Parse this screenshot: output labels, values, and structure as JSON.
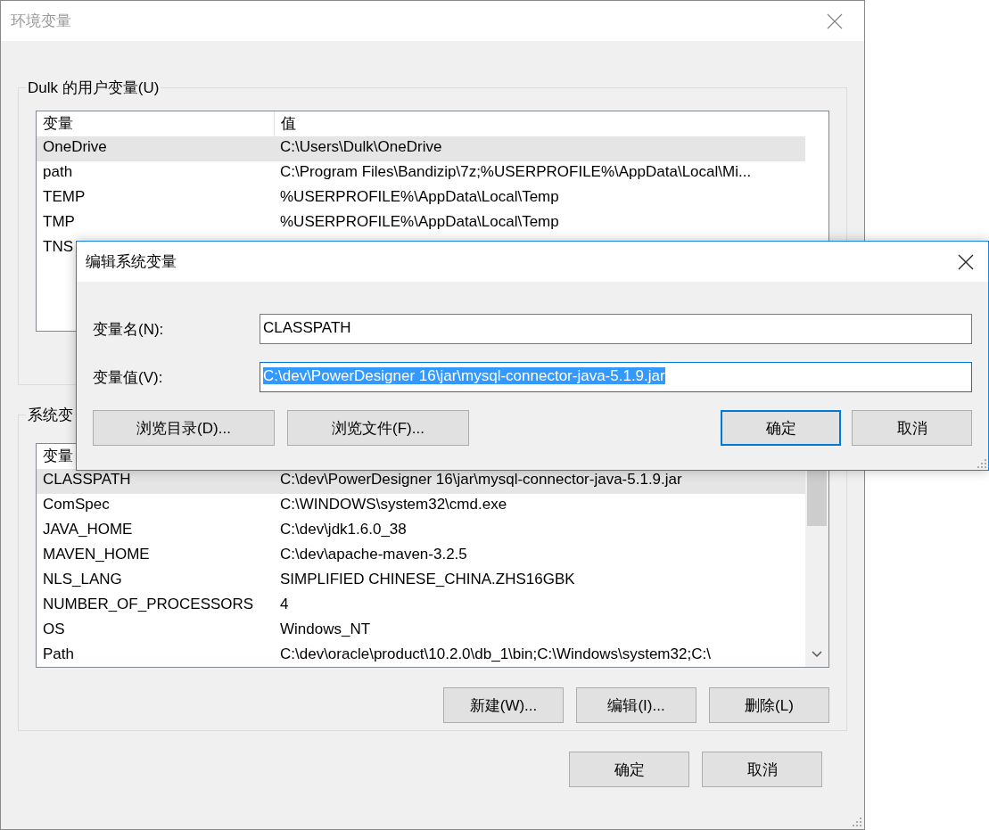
{
  "window": {
    "title": "环境变量"
  },
  "user_variables": {
    "label": "Dulk 的用户变量(U)",
    "columns": [
      "变量",
      "值"
    ],
    "rows": [
      {
        "name": "OneDrive",
        "value": "C:\\Users\\Dulk\\OneDrive",
        "selected": true
      },
      {
        "name": "path",
        "value": "C:\\Program Files\\Bandizip\\7z;%USERPROFILE%\\AppData\\Local\\Mi...",
        "selected": false
      },
      {
        "name": "TEMP",
        "value": "%USERPROFILE%\\AppData\\Local\\Temp",
        "selected": false
      },
      {
        "name": "TMP",
        "value": "%USERPROFILE%\\AppData\\Local\\Temp",
        "selected": false
      },
      {
        "name": "TNS",
        "selected": false
      }
    ]
  },
  "system_variables": {
    "label": "系统变",
    "columns": [
      "变量"
    ],
    "rows": [
      {
        "name": "CLASSPATH",
        "value": "C:\\dev\\PowerDesigner 16\\jar\\mysql-connector-java-5.1.9.jar",
        "selected": true
      },
      {
        "name": "ComSpec",
        "value": "C:\\WINDOWS\\system32\\cmd.exe",
        "selected": false
      },
      {
        "name": "JAVA_HOME",
        "value": "C:\\dev\\jdk1.6.0_38",
        "selected": false
      },
      {
        "name": "MAVEN_HOME",
        "value": "C:\\dev\\apache-maven-3.2.5",
        "selected": false
      },
      {
        "name": "NLS_LANG",
        "value": "SIMPLIFIED CHINESE_CHINA.ZHS16GBK",
        "selected": false
      },
      {
        "name": "NUMBER_OF_PROCESSORS",
        "value": "4",
        "selected": false
      },
      {
        "name": "OS",
        "value": "Windows_NT",
        "selected": false
      },
      {
        "name": "Path",
        "value": "C:\\dev\\oracle\\product\\10.2.0\\db_1\\bin;C:\\Windows\\system32;C:\\",
        "selected": false
      }
    ],
    "buttons": [
      "新建(W)...",
      "编辑(I)...",
      "删除(L)"
    ]
  },
  "buttons": [
    "确定",
    "取消"
  ],
  "edit_dialog": {
    "title": "编辑系统变量",
    "fields": [
      {
        "label": "变量名(N):",
        "value": "CLASSPATH",
        "text_selected": false
      },
      {
        "label": "变量值(V):",
        "value": "C:\\dev\\PowerDesigner 16\\jar\\mysql-connector-java-5.1.9.jar",
        "text_selected": true
      }
    ],
    "browse_buttons": [
      "浏览目录(D)...",
      "浏览文件(F)..."
    ],
    "buttons": [
      {
        "label": "确定",
        "focused": true
      },
      {
        "label": "取消",
        "focused": false
      }
    ]
  }
}
